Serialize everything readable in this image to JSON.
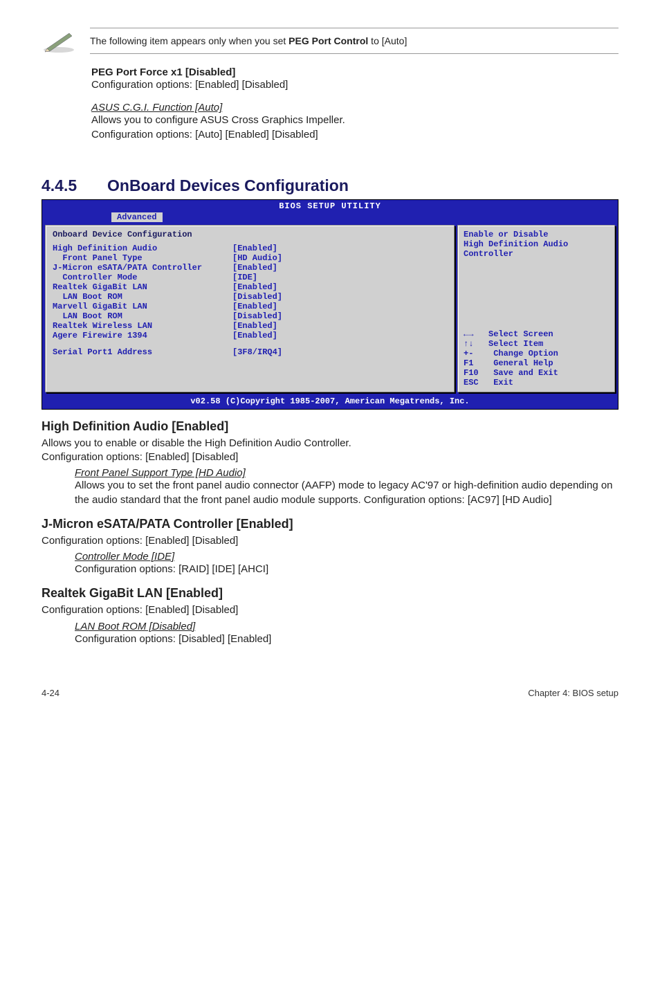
{
  "note": {
    "text_before": "The following item appears only when you set ",
    "bold": "PEG Port Control",
    "text_after": " to [Auto]"
  },
  "peg_force": {
    "title": "PEG Port Force x1 [Disabled]",
    "body": "Configuration options: [Enabled] [Disabled]"
  },
  "asus_cgi": {
    "title": "ASUS C.G.I. Function [Auto]",
    "line1": "Allows you to configure ASUS Cross Graphics Impeller.",
    "line2": "Configuration options: [Auto] [Enabled] [Disabled]"
  },
  "section": {
    "num": "4.4.5",
    "title": "OnBoard Devices Configuration"
  },
  "bios": {
    "title": "BIOS SETUP UTILITY",
    "tab": "Advanced",
    "panel_title": "Onboard Device Configuration",
    "rows": [
      {
        "k": "High Definition Audio",
        "v": "[Enabled]",
        "indent": 0
      },
      {
        "k": "Front Panel Type",
        "v": "[HD Audio]",
        "indent": 1
      },
      {
        "k": "J-Micron eSATA/PATA Controller",
        "v": "[Enabled]",
        "indent": 0
      },
      {
        "k": "Controller Mode",
        "v": "[IDE]",
        "indent": 1
      },
      {
        "k": "Realtek GigaBit LAN",
        "v": "[Enabled]",
        "indent": 0
      },
      {
        "k": "LAN Boot ROM",
        "v": "[Disabled]",
        "indent": 1
      },
      {
        "k": "Marvell GigaBit LAN",
        "v": "[Enabled]",
        "indent": 0
      },
      {
        "k": "LAN Boot ROM",
        "v": "[Disabled]",
        "indent": 1
      },
      {
        "k": "Realtek Wireless LAN",
        "v": "[Enabled]",
        "indent": 0
      },
      {
        "k": "Agere Firewire 1394",
        "v": "[Enabled]",
        "indent": 0
      }
    ],
    "serial": {
      "k": "Serial Port1 Address",
      "v": "[3F8/IRQ4]"
    },
    "help": {
      "line1": "Enable or Disable",
      "line2": "High Definition Audio",
      "line3": "Controller"
    },
    "nav": [
      {
        "sym": "←→ ",
        "label": "Select Screen"
      },
      {
        "sym": "↑↓ ",
        "label": "Select Item"
      },
      {
        "sym": "+-  ",
        "label": "Change Option"
      },
      {
        "sym": "F1  ",
        "label": "General Help"
      },
      {
        "sym": "F10 ",
        "label": "Save and Exit"
      },
      {
        "sym": "ESC ",
        "label": "Exit"
      }
    ],
    "footer": "v02.58 (C)Copyright 1985-2007, American Megatrends, Inc."
  },
  "hd_audio": {
    "title": "High Definition Audio [Enabled]",
    "line1": "Allows you to enable or disable the High Definition Audio Controller.",
    "line2": "Configuration options: [Enabled] [Disabled]",
    "sub_title": "Front Panel Support Type [HD Audio]",
    "sub_body": "Allows you to set the front panel audio connector (AAFP) mode to legacy AC'97 or high-definition audio depending on the audio standard that the front panel audio module supports. Configuration options: [AC97] [HD Audio]"
  },
  "jmicron": {
    "title": "J-Micron eSATA/PATA Controller [Enabled]",
    "line1": "Configuration options: [Enabled] [Disabled]",
    "sub_title": "Controller Mode [IDE]",
    "sub_body": "Configuration options: [RAID] [IDE] [AHCI]"
  },
  "realtek": {
    "title": "Realtek GigaBit LAN [Enabled]",
    "line1": "Configuration options: [Enabled] [Disabled]",
    "sub_title": "LAN Boot ROM [Disabled]",
    "sub_body": "Configuration options: [Disabled] [Enabled]"
  },
  "footer": {
    "left": "4-24",
    "right": "Chapter 4: BIOS setup"
  }
}
